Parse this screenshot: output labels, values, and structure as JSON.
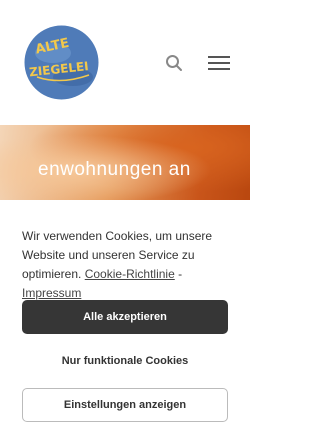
{
  "logo": {
    "line1": "ALTE",
    "line2": "ZIEGELEI"
  },
  "header": {
    "search_icon": "search-icon",
    "menu_icon": "hamburger-menu-icon"
  },
  "hero": {
    "title": "enwohnungen an"
  },
  "cookie": {
    "text": "Wir verwenden Cookies, um unsere Website und unseren Service zu optimieren.",
    "policy_link": "Cookie-Richtlinie",
    "separator": " - ",
    "imprint_link": "Impressum",
    "accept_label": "Alle akzeptieren",
    "functional_label": "Nur funktionale Cookies",
    "settings_label": "Einstellungen anzeigen"
  },
  "colors": {
    "accept_bg": "#363636",
    "logo_blue": "#4f7bb8",
    "logo_text": "#f2c84b"
  }
}
